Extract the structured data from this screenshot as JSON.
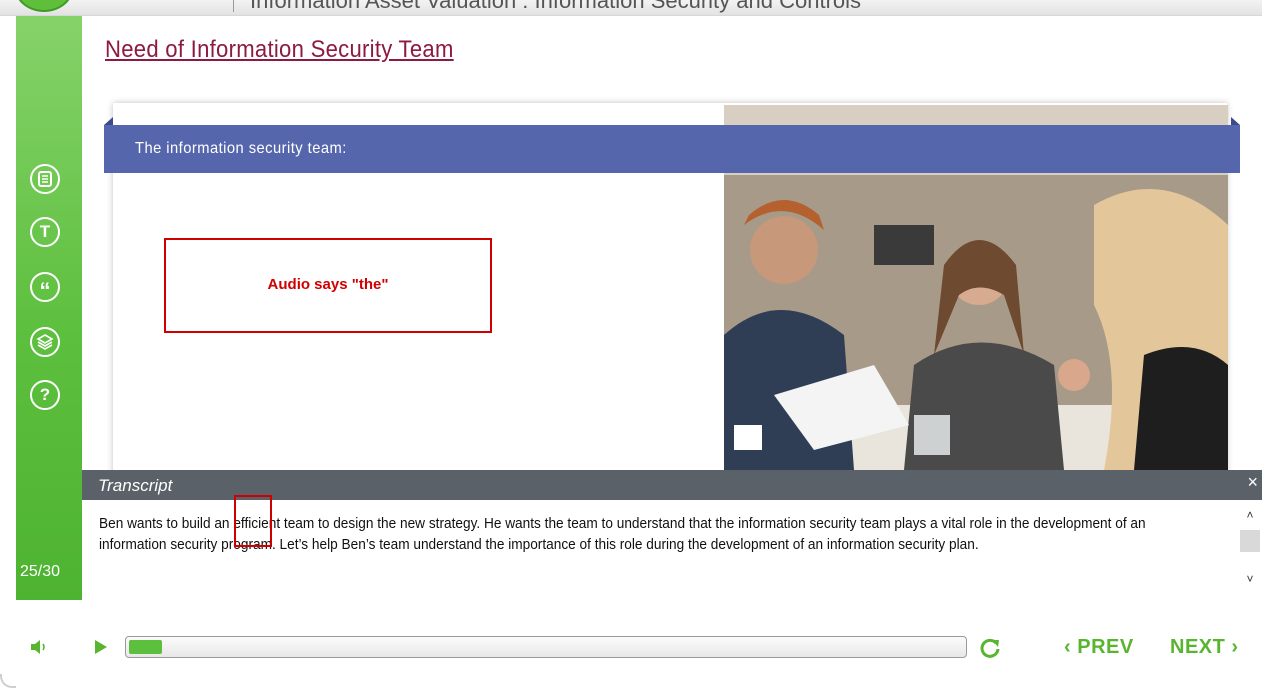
{
  "header": {
    "course_title": "Information Asset Valuation : Information Security and Controls"
  },
  "sidebar": {
    "icons": [
      "document-icon",
      "glossary-t-icon",
      "quote-icon",
      "layers-icon",
      "help-icon"
    ],
    "help_glyph": "?",
    "glossary_glyph": "T",
    "quote_glyph": "“",
    "page_counter": "25/30",
    "accent_color": "#5cbf3d"
  },
  "slide": {
    "title": "Need of Information Security Team",
    "band_title": "The information security team:",
    "band_color": "#5666ad"
  },
  "annotation": {
    "note": "Audio says \"the\"",
    "color": "#d00000"
  },
  "transcript": {
    "title": "Transcript",
    "close_glyph": "×",
    "text": "Ben wants to build an efficient team to design the new strategy. He wants the team to understand that the information security team plays a vital role in the development of an information security program. Let’s help Ben’s team understand the importance of this role during the development of an information security plan.",
    "scroll_up": "˄",
    "scroll_down": "˅"
  },
  "player": {
    "progress_fraction": 0.04,
    "prev_label": "PREV",
    "next_label": "NEXT",
    "prev_glyph": "‹",
    "next_glyph": "›"
  }
}
